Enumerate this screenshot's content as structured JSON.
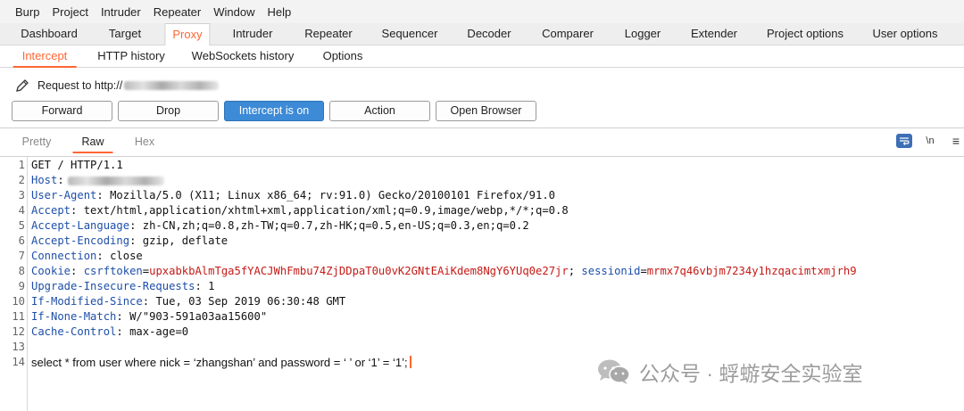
{
  "menu": [
    "Burp",
    "Project",
    "Intruder",
    "Repeater",
    "Window",
    "Help"
  ],
  "main_tabs": [
    "Dashboard",
    "Target",
    "Proxy",
    "Intruder",
    "Repeater",
    "Sequencer",
    "Decoder",
    "Comparer",
    "Logger",
    "Extender",
    "Project options",
    "User options"
  ],
  "main_tab_active": "Proxy",
  "sub_tabs": [
    "Intercept",
    "HTTP history",
    "WebSockets history",
    "Options"
  ],
  "sub_tab_active": "Intercept",
  "request_label": "Request to http://",
  "buttons": {
    "forward": "Forward",
    "drop": "Drop",
    "intercept": "Intercept is on",
    "action": "Action",
    "open_browser": "Open Browser"
  },
  "editor_tabs": [
    "Pretty",
    "Raw",
    "Hex"
  ],
  "editor_tab_active": "Raw",
  "editor_tools": {
    "newline": "\\n",
    "menu": "≡"
  },
  "request": {
    "line1": "GET / HTTP/1.1",
    "host_key": "Host",
    "user_agent_key": "User-Agent",
    "user_agent": "Mozilla/5.0 (X11; Linux x86_64; rv:91.0) Gecko/20100101 Firefox/91.0",
    "accept_key": "Accept",
    "accept": "text/html,application/xhtml+xml,application/xml;q=0.9,image/webp,*/*;q=0.8",
    "accept_language_key": "Accept-Language",
    "accept_language": "zh-CN,zh;q=0.8,zh-TW;q=0.7,zh-HK;q=0.5,en-US;q=0.3,en;q=0.2",
    "accept_encoding_key": "Accept-Encoding",
    "accept_encoding": "gzip, deflate",
    "connection_key": "Connection",
    "connection": "close",
    "cookie_key": "Cookie",
    "csrf_name": "csrftoken",
    "csrf_value": "upxabkbAlmTga5fYACJWhFmbu74ZjDDpaT0u0vK2GNtEAiKdem8NgY6YUq0e27jr",
    "session_name": "sessionid",
    "session_value": "mrmx7q46vbjm7234y1hzqacimtxmjrh9",
    "upgrade_key": "Upgrade-Insecure-Requests",
    "upgrade": "1",
    "if_modified_key": "If-Modified-Since",
    "if_modified": "Tue, 03 Sep 2019 06:30:48 GMT",
    "if_none_key": "If-None-Match",
    "if_none": "W/\"903-591a03aa15600\"",
    "cache_key": "Cache-Control",
    "cache": "max-age=0",
    "line14": "select * from user where nick = ‘zhangshan’ and password = ‘ ’ or ‘1’ = ‘1’;"
  },
  "line_numbers": [
    "1",
    "2",
    "3",
    "4",
    "5",
    "6",
    "7",
    "8",
    "9",
    "10",
    "11",
    "12",
    "13",
    "14"
  ],
  "watermark": "公众号 · 蜉蝣安全实验室",
  "colors": {
    "accent": "#ff6633",
    "button_active": "#3d8ad6",
    "header_key": "#1e4fa8",
    "cookie_value": "#c41a16"
  }
}
